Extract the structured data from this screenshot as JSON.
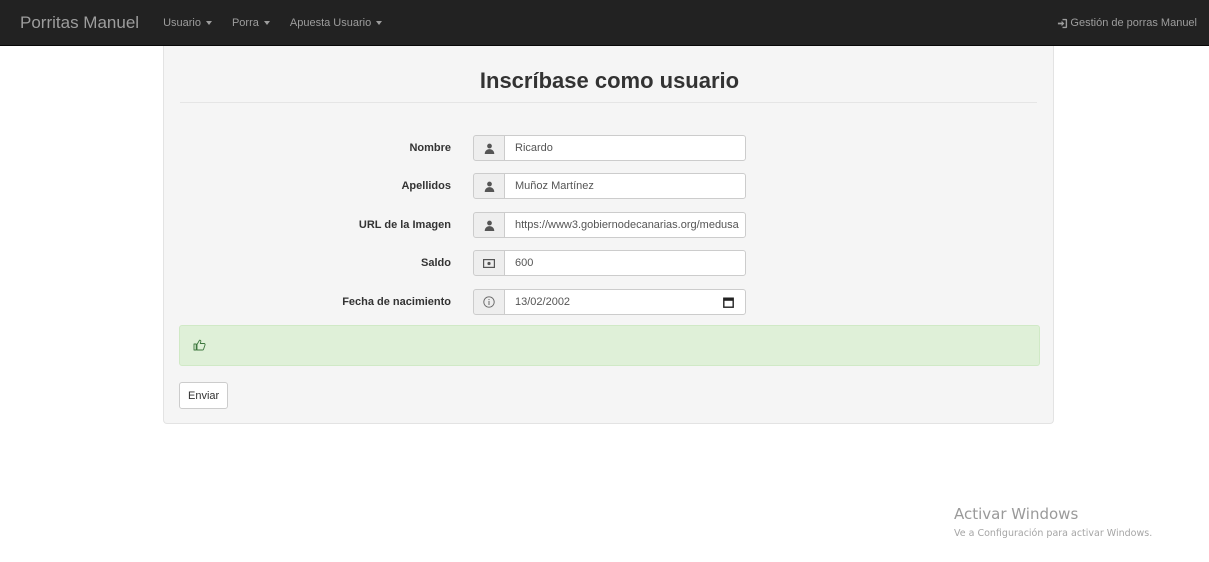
{
  "navbar": {
    "brand": "Porritas Manuel",
    "menus": [
      {
        "label": "Usuario"
      },
      {
        "label": "Porra"
      },
      {
        "label": "Apuesta Usuario"
      }
    ],
    "right_link": "Gestión de porras Manuel",
    "right_icon": "log-in-icon"
  },
  "form": {
    "title": "Inscríbase como usuario",
    "fields": [
      {
        "label": "Nombre",
        "value": "Ricardo",
        "icon": "user-icon"
      },
      {
        "label": "Apellidos",
        "value": "Muñoz Martínez",
        "icon": "user-icon"
      },
      {
        "label": "URL de la Imagen",
        "value": "https://www3.gobiernodecanarias.org/medusa",
        "icon": "user-icon"
      },
      {
        "label": "Saldo",
        "value": "600",
        "icon": "money-icon"
      },
      {
        "label": "Fecha de nacimiento",
        "value": "13/02/2002",
        "icon": "info-icon"
      }
    ],
    "alert_icon": "thumbs-up-icon",
    "submit_label": "Enviar"
  },
  "watermark": {
    "title": "Activar Windows",
    "subtitle": "Ve a Configuración para activar Windows."
  },
  "colors": {
    "navbar_bg": "#222222",
    "nav_text": "#9d9d9d",
    "panel_bg": "#f5f5f5",
    "alert_bg": "#dff0d8"
  }
}
